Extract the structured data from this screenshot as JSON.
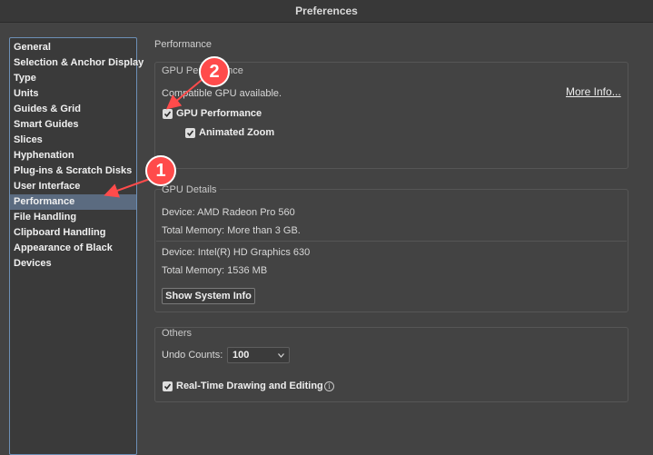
{
  "window": {
    "title": "Preferences"
  },
  "sidebar": {
    "items": [
      {
        "label": "General"
      },
      {
        "label": "Selection & Anchor Display"
      },
      {
        "label": "Type"
      },
      {
        "label": "Units"
      },
      {
        "label": "Guides & Grid"
      },
      {
        "label": "Smart Guides"
      },
      {
        "label": "Slices"
      },
      {
        "label": "Hyphenation"
      },
      {
        "label": "Plug-ins & Scratch Disks"
      },
      {
        "label": "User Interface"
      },
      {
        "label": "Performance"
      },
      {
        "label": "File Handling"
      },
      {
        "label": "Clipboard Handling"
      },
      {
        "label": "Appearance of Black"
      },
      {
        "label": "Devices"
      }
    ],
    "selected": "Performance"
  },
  "panel": {
    "title": "Performance",
    "gpu_performance": {
      "title": "GPU Performance",
      "status": "Compatible GPU available.",
      "more_info": "More Info...",
      "gpu_checkbox": {
        "label": "GPU Performance",
        "checked": true
      },
      "animated_zoom": {
        "label": "Animated Zoom",
        "checked": true
      }
    },
    "gpu_details": {
      "title": "GPU Details",
      "device1": "Device: AMD Radeon Pro 560",
      "memory1": "Total Memory:  More than 3 GB.",
      "device2": "Device: Intel(R) HD Graphics 630",
      "memory2": "Total Memory: 1536 MB",
      "button": "Show System Info"
    },
    "others": {
      "title": "Others",
      "undo_label": "Undo Counts:",
      "undo_value": "100",
      "realtime": {
        "label": "Real-Time Drawing and Editing",
        "checked": true
      },
      "info_glyph": "i"
    }
  },
  "annotations": {
    "badge1": "1",
    "badge2": "2",
    "color": "#ff4b4b"
  }
}
